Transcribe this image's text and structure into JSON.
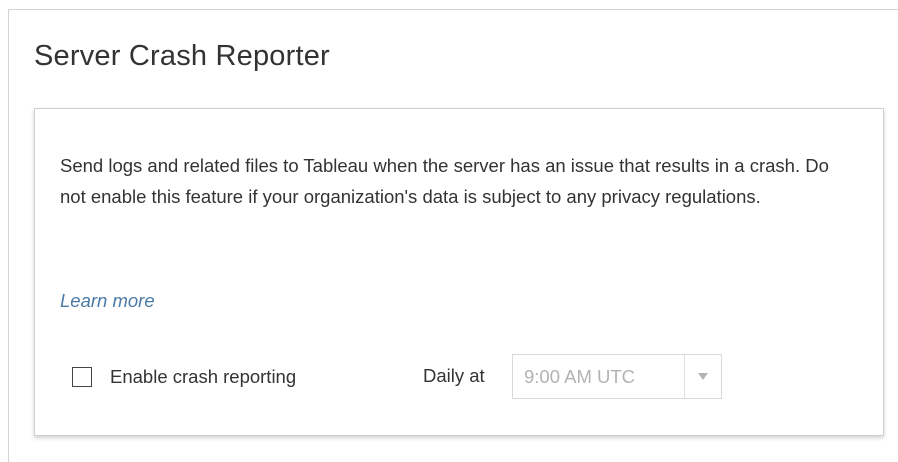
{
  "section": {
    "title": "Server Crash Reporter"
  },
  "card": {
    "description": "Send logs and related files to Tableau when the server has an issue that results in a crash. Do not enable this feature if your organization's data is subject to any privacy regulations.",
    "learn_more_label": "Learn more",
    "enable_checkbox": {
      "label": "Enable crash reporting",
      "checked": false
    },
    "schedule": {
      "label": "Daily at",
      "selected_time": "9:00 AM UTC",
      "disabled": true
    }
  },
  "colors": {
    "text": "#333333",
    "link": "#4a7aa5",
    "disabled_text": "#b3b3b3",
    "border": "#cfcfcf"
  },
  "icons": {
    "dropdown": "chevron-down-icon"
  }
}
